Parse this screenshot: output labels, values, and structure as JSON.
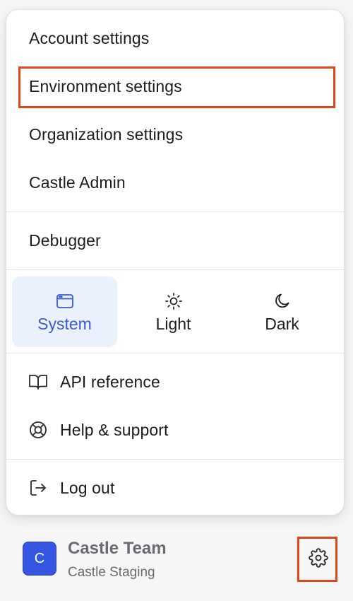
{
  "menu": {
    "items": [
      {
        "label": "Account settings"
      },
      {
        "label": "Environment settings"
      },
      {
        "label": "Organization settings"
      },
      {
        "label": "Castle Admin"
      }
    ],
    "debugger_label": "Debugger",
    "theme": {
      "options": [
        {
          "label": "System",
          "icon": "browser-window-icon",
          "active": true
        },
        {
          "label": "Light",
          "icon": "sun-icon",
          "active": false
        },
        {
          "label": "Dark",
          "icon": "moon-icon",
          "active": false
        }
      ],
      "active_color": "#3a5ad0",
      "active_bg": "#ebf0fd"
    },
    "links": [
      {
        "label": "API reference",
        "icon": "book-open-icon"
      },
      {
        "label": "Help & support",
        "icon": "life-buoy-icon"
      }
    ],
    "logout_label": "Log out",
    "highlight_color": "#e0461c"
  },
  "footer": {
    "avatar_letter": "C",
    "team_name": "Castle Team",
    "environment": "Castle Staging",
    "avatar_color": "#3556e0"
  }
}
